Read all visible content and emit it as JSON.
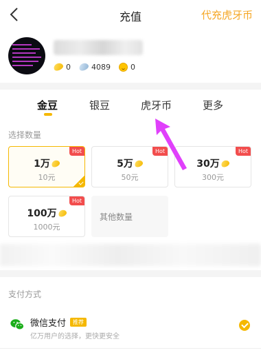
{
  "header": {
    "title": "充值",
    "right_link": "代充虎牙币"
  },
  "profile": {
    "balances": {
      "gold_beans": "0",
      "silver_beans": "4089",
      "huya_coins": "0"
    }
  },
  "tabs": [
    {
      "label": "金豆",
      "active": true
    },
    {
      "label": "银豆",
      "active": false
    },
    {
      "label": "虎牙币",
      "active": false
    },
    {
      "label": "更多",
      "active": false
    }
  ],
  "amount_section": {
    "label": "选择数量",
    "hot_label": "Hot",
    "options": [
      {
        "amount": "1万",
        "price": "10元",
        "hot": true,
        "selected": true
      },
      {
        "amount": "5万",
        "price": "50元",
        "hot": true,
        "selected": false
      },
      {
        "amount": "30万",
        "price": "300元",
        "hot": true,
        "selected": false
      },
      {
        "amount": "100万",
        "price": "1000元",
        "hot": true,
        "selected": false
      }
    ],
    "other": "其他数量"
  },
  "payment": {
    "label": "支付方式",
    "methods": [
      {
        "name": "微信支付",
        "tag": "推荐",
        "desc": "亿万用户的选择，更快更安全",
        "selected": true
      }
    ]
  },
  "colors": {
    "accent": "#f5b800",
    "link": "#f5a623",
    "hot": "#f24d4d",
    "wechat": "#1aad19",
    "annotation": "#e040fb"
  }
}
